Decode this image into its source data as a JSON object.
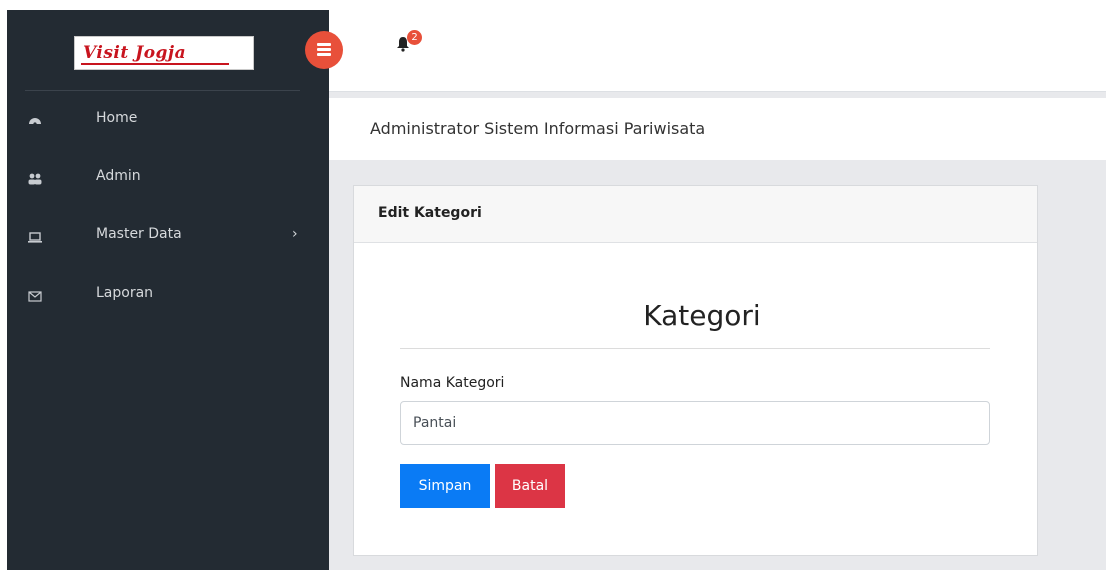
{
  "brand": {
    "logo_text": "Visit Jogja",
    "logo_color": "#c8141e"
  },
  "sidebar": {
    "items": [
      {
        "label": "Home",
        "icon": "dashboard-icon"
      },
      {
        "label": "Admin",
        "icon": "users-icon"
      },
      {
        "label": "Master Data",
        "icon": "laptop-icon",
        "chevron": "›"
      },
      {
        "label": "Laporan",
        "icon": "envelope-icon"
      }
    ]
  },
  "topbar": {
    "notification_count": "2"
  },
  "page": {
    "title": "Administrator Sistem Informasi Pariwisata"
  },
  "card": {
    "header": "Edit Kategori",
    "form_title": "Kategori",
    "field_label": "Nama Kategori",
    "field_value": "Pantai",
    "save_label": "Simpan",
    "cancel_label": "Batal"
  },
  "colors": {
    "sidebar": "#232b33",
    "accent": "#e8503a",
    "primary": "#0a7bf5",
    "danger": "#dc3545"
  }
}
